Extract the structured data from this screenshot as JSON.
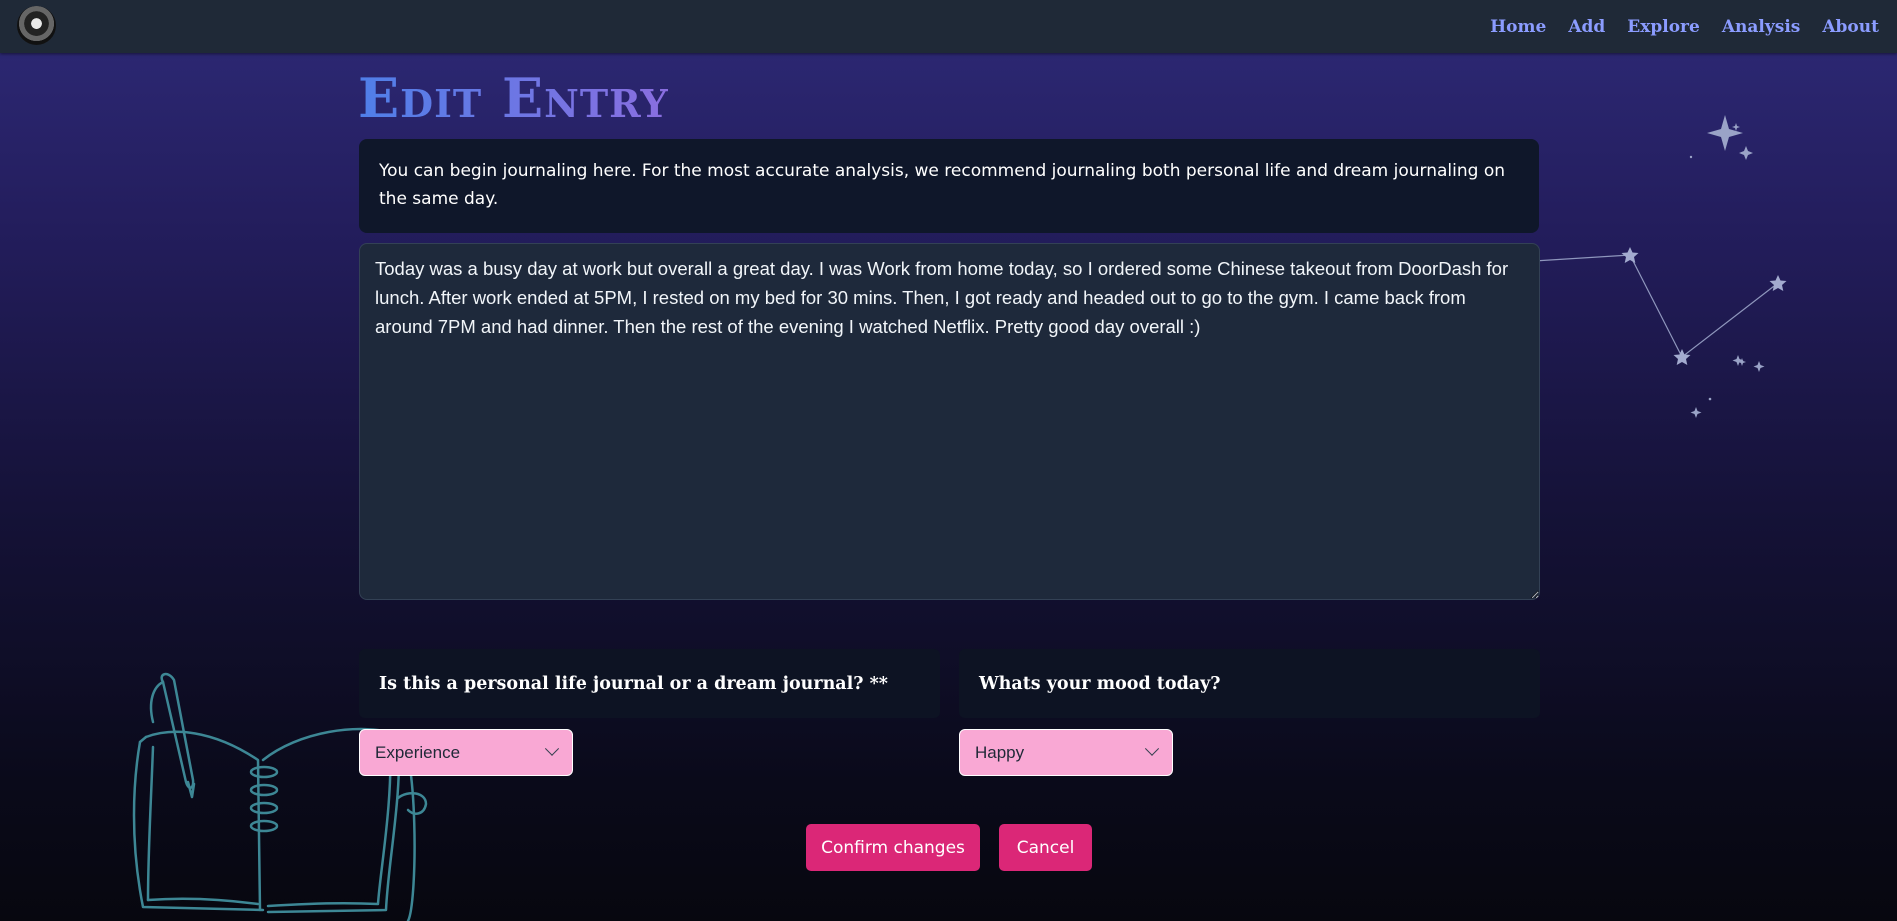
{
  "nav": {
    "links": [
      "Home",
      "Add",
      "Explore",
      "Analysis",
      "About"
    ]
  },
  "page": {
    "title": "Edit Entry",
    "info_text": "You can begin journaling here. For the most accurate analysis, we recommend journaling both personal life and dream journaling on the same day."
  },
  "entry": {
    "value": "Today was a busy day at work but overall a great day. I was Work from home today, so I ordered some Chinese takeout from DoorDash for lunch. After work ended at 5PM, I rested on my bed for 30 mins. Then, I got ready and headed out to go to the gym. I came back from around 7PM and had dinner. Then the rest of the evening I watched Netflix. Pretty good day overall :)"
  },
  "journal_type": {
    "question": "Is this a personal life journal or a dream journal? **",
    "selected": "Experience"
  },
  "mood": {
    "question": "Whats your mood today?",
    "selected": "Happy"
  },
  "actions": {
    "confirm_label": "Confirm changes",
    "cancel_label": "Cancel"
  },
  "colors": {
    "accent": "#db2777",
    "select_bg": "#f9a8d4",
    "nav_link": "#8b9cff"
  },
  "icons": {
    "avatar": "avatar",
    "select_arrow": "chevron-down-icon",
    "decoration_left": "notebook-pen-illustration",
    "decoration_right": "constellation-stars"
  }
}
